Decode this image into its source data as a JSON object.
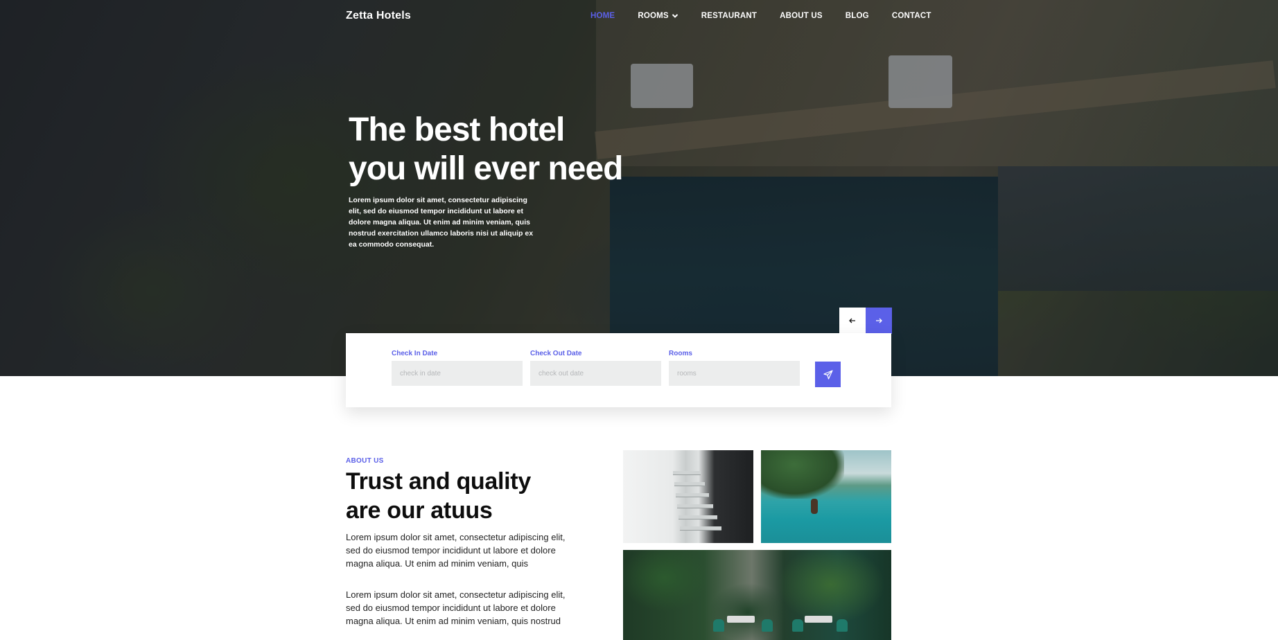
{
  "nav": {
    "brand": "Zetta Hotels",
    "items": [
      {
        "label": "HOME",
        "active": true
      },
      {
        "label": "ROOMS",
        "dropdown": true
      },
      {
        "label": "RESTAURANT"
      },
      {
        "label": "ABOUT US"
      },
      {
        "label": "BLOG"
      },
      {
        "label": "CONTACT"
      }
    ]
  },
  "hero": {
    "title_line1": "The best hotel",
    "title_line2": "you will ever need",
    "text": "Lorem ipsum dolor sit amet, consectetur adipiscing elit, sed do eiusmod tempor incididunt ut labore et dolore magna aliqua. Ut enim ad minim veniam, quis nostrud exercitation ullamco laboris nisi ut aliquip ex ea commodo consequat.",
    "prev_icon": "arrow-left-icon",
    "next_icon": "arrow-right-icon"
  },
  "booking": {
    "check_in": {
      "label": "Check In Date",
      "placeholder": "check in date",
      "value": ""
    },
    "check_out": {
      "label": "Check Out Date",
      "placeholder": "check out date",
      "value": ""
    },
    "rooms": {
      "label": "Rooms",
      "placeholder": "rooms",
      "value": ""
    },
    "submit_icon": "paper-plane-icon"
  },
  "about": {
    "eyebrow": "ABOUT US",
    "title_line1": "Trust and quality",
    "title_line2": "are our atuus",
    "paragraph1": "Lorem ipsum dolor sit amet, consectetur adipiscing elit, sed do eiusmod tempor incididunt ut labore et dolore magna aliqua. Ut enim ad minim veniam, quis",
    "paragraph2": "Lorem ipsum dolor sit amet, consectetur adipiscing elit, sed do eiusmod tempor incididunt ut labore et dolore magna aliqua. Ut enim ad minim veniam, quis nostrud"
  },
  "colors": {
    "accent": "#5b60e8",
    "input_bg": "#eceded",
    "text_dark": "#0d0d0d"
  }
}
